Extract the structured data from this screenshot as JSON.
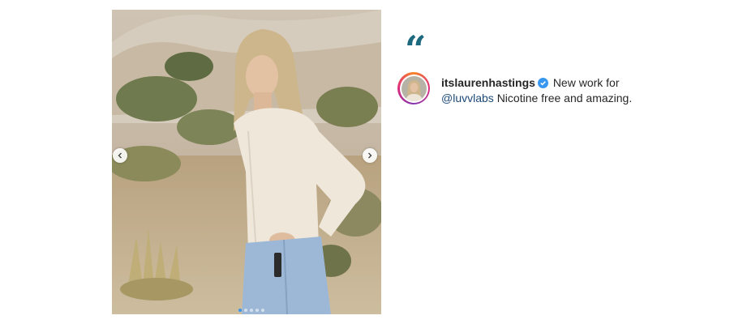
{
  "post": {
    "username": "itslaurenhastings",
    "caption_before_mention": "New work for",
    "mention": "@luvvlabs",
    "caption_after_mention": "Nicotine free and amazing.",
    "quote_mark": "“"
  },
  "carousel": {
    "slide_count": 5,
    "active_slide": 1,
    "prev_icon": "chevron-left-icon",
    "next_icon": "chevron-right-icon"
  },
  "colors": {
    "quote": "#1d6a80",
    "mention": "#1e4a78",
    "verified": "#3897f0",
    "text": "#262626"
  }
}
